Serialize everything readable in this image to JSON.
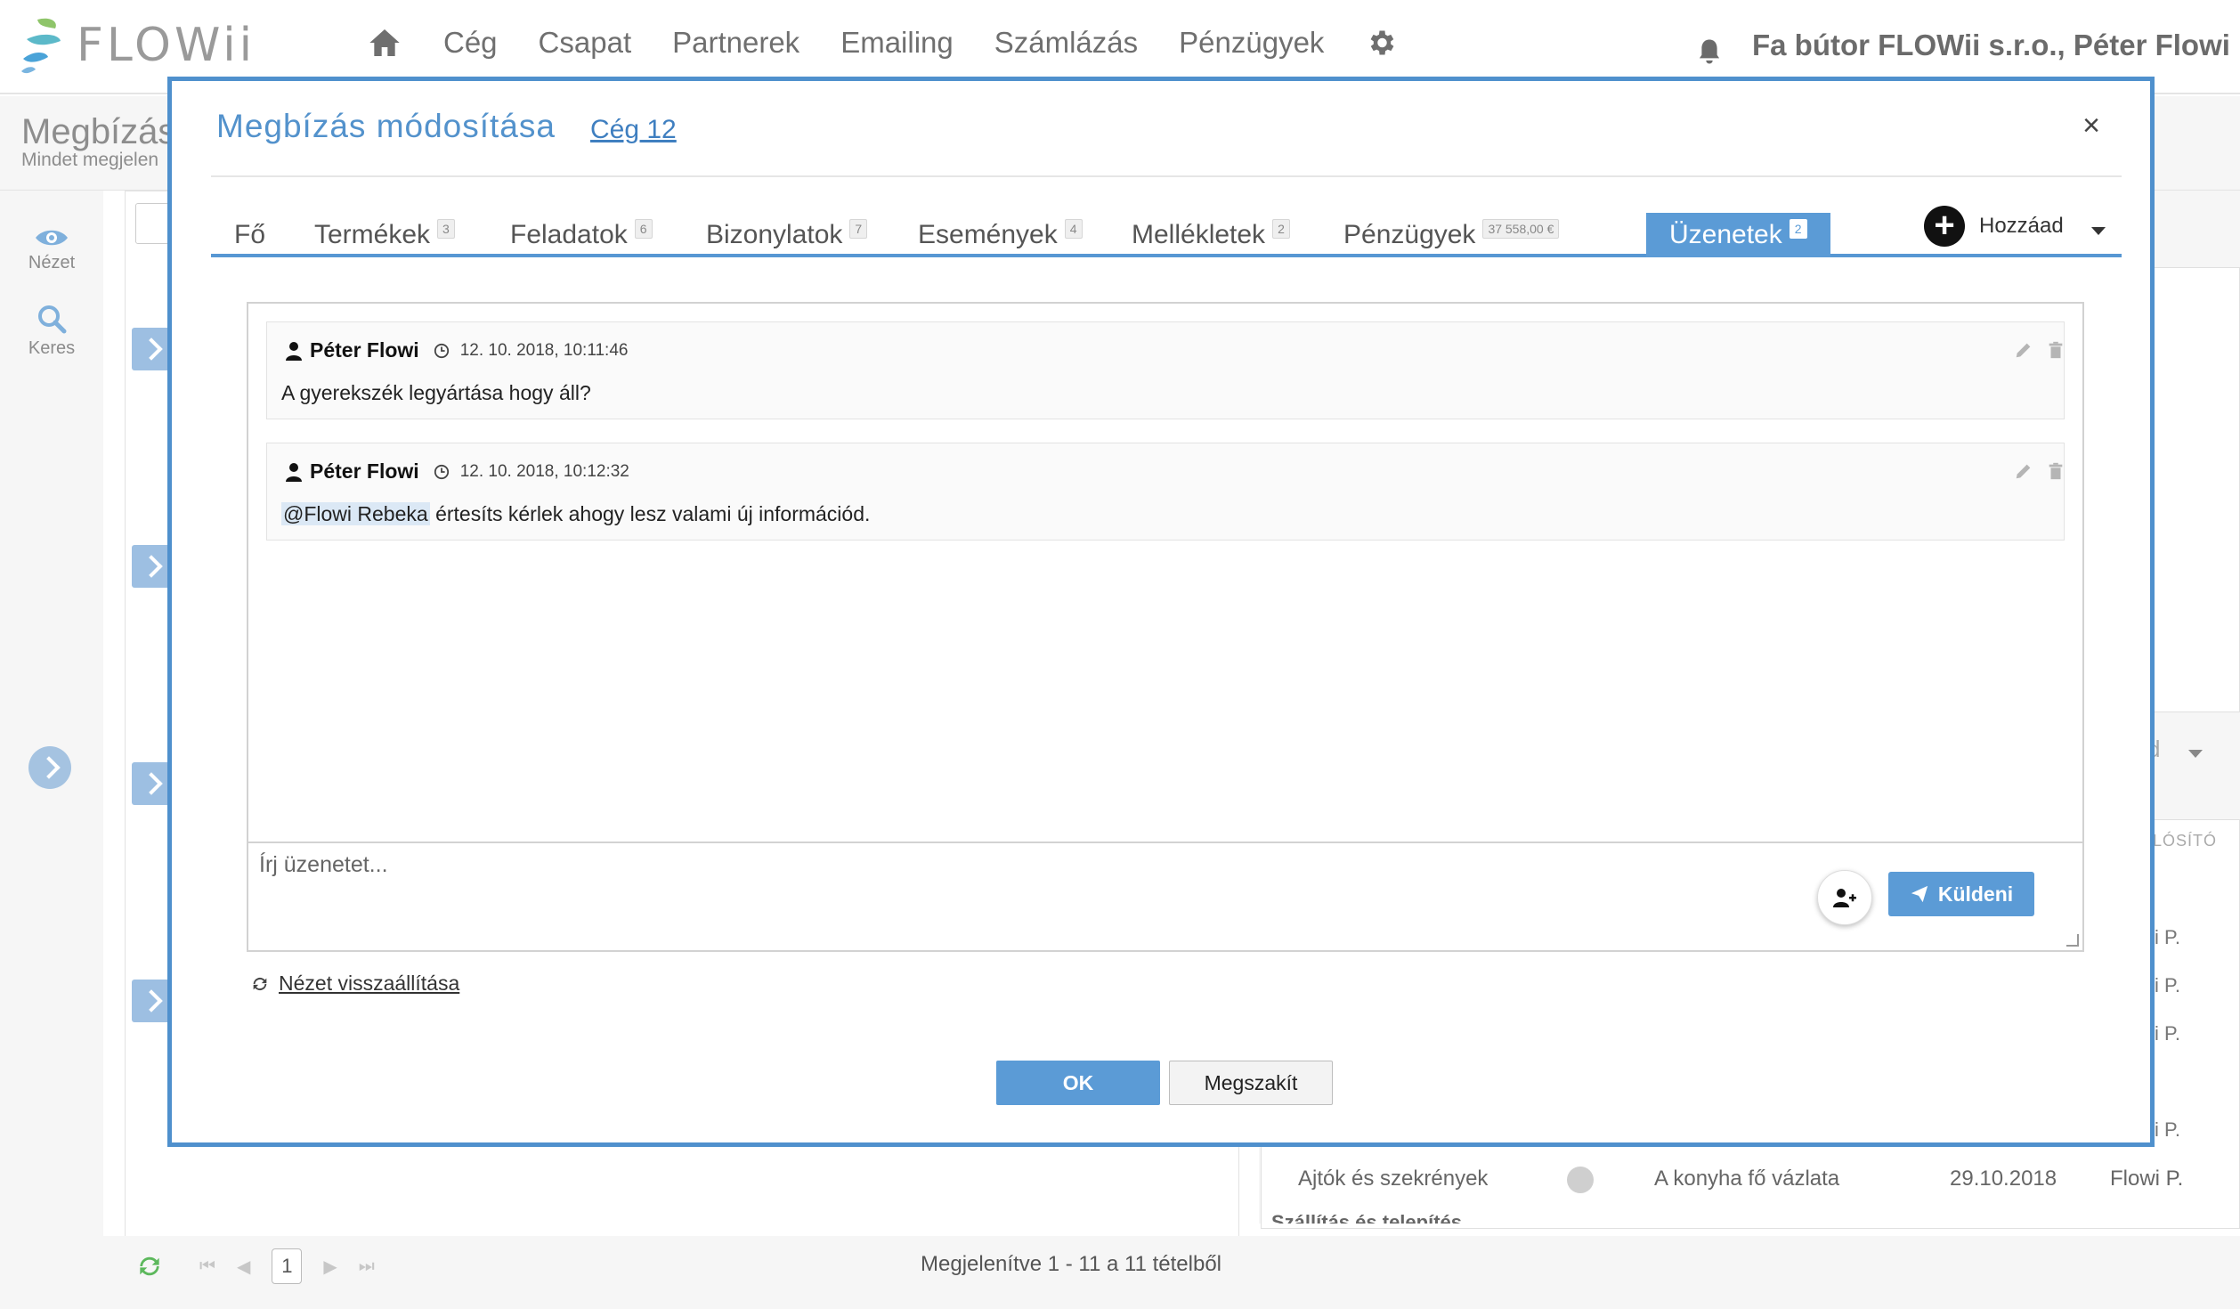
{
  "app": {
    "logo_text": "FLOWii",
    "nav": [
      "Cég",
      "Csapat",
      "Partnerek",
      "Emailing",
      "Számlázás",
      "Pénzügyek"
    ],
    "user_company": "Fa bútor FLOWii s.r.o., Péter Flowi"
  },
  "background": {
    "page_title": "Megbízás",
    "page_subtitle": "Mindet megjelen",
    "sidebar": [
      {
        "label": "Nézet",
        "icon": "eye-icon"
      },
      {
        "label": "Keres",
        "icon": "search-icon"
      }
    ],
    "right_column_header": "LÓSÍTÓ",
    "right_dropdown_peek": "d",
    "peek_values": [
      "i P.",
      "i P.",
      "i P.",
      "i P."
    ],
    "table_row": {
      "name": "Ajtók és szekrények",
      "description": "A konyha fő vázlata",
      "date": "29.10.2018",
      "owner": "Flowi P."
    },
    "cut_row": "Szállítás és telepítés",
    "pager": {
      "page": "1"
    },
    "showing_text": "Megjelenítve 1 - 11 a 11 tételből"
  },
  "modal": {
    "title": "Megbízás módosítása",
    "link": "Cég 12",
    "close": "×",
    "tabs": [
      {
        "label": "Fő",
        "badge": ""
      },
      {
        "label": "Termékek",
        "badge": "3"
      },
      {
        "label": "Feladatok",
        "badge": "6"
      },
      {
        "label": "Bizonylatok",
        "badge": "7"
      },
      {
        "label": "Események",
        "badge": "4"
      },
      {
        "label": "Mellékletek",
        "badge": "2"
      },
      {
        "label": "Pénzügyek",
        "badge": "37 558,00 €"
      },
      {
        "label": "Üzenetek",
        "badge": "2",
        "active": true
      }
    ],
    "add_label": "Hozzáad",
    "messages": [
      {
        "author": "Péter Flowi",
        "time": "12. 10. 2018, 10:11:46",
        "text": "A gyerekszék legyártása hogy áll?"
      },
      {
        "author": "Péter Flowi",
        "time": "12. 10. 2018, 10:12:32",
        "mention": "@Flowi Rebeka",
        "text": " értesíts kérlek ahogy lesz valami új információd."
      }
    ],
    "compose_placeholder": "Írj üzenetet...",
    "send_label": "Küldeni",
    "reset_view": "Nézet visszaállítása",
    "ok_label": "OK",
    "cancel_label": "Megszakít"
  },
  "colors": {
    "accent": "#5b9bd6",
    "modal_border": "#4f90cd",
    "title": "#5392cc"
  }
}
